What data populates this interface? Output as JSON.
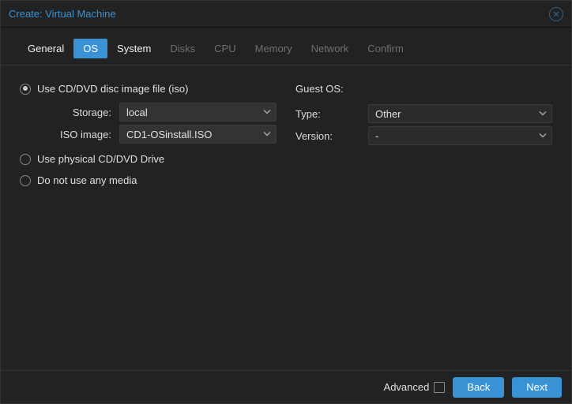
{
  "title": "Create: Virtual Machine",
  "tabs": [
    {
      "label": "General",
      "state": "enabled"
    },
    {
      "label": "OS",
      "state": "active"
    },
    {
      "label": "System",
      "state": "enabled"
    },
    {
      "label": "Disks",
      "state": "disabled"
    },
    {
      "label": "CPU",
      "state": "disabled"
    },
    {
      "label": "Memory",
      "state": "disabled"
    },
    {
      "label": "Network",
      "state": "disabled"
    },
    {
      "label": "Confirm",
      "state": "disabled"
    }
  ],
  "media": {
    "opt_iso": "Use CD/DVD disc image file (iso)",
    "opt_physical": "Use physical CD/DVD Drive",
    "opt_none": "Do not use any media",
    "storage_label": "Storage:",
    "storage_value": "local",
    "iso_label": "ISO image:",
    "iso_value": "CD1-OSinstall.ISO"
  },
  "guest": {
    "heading": "Guest OS:",
    "type_label": "Type:",
    "type_value": "Other",
    "version_label": "Version:",
    "version_value": "-"
  },
  "footer": {
    "advanced": "Advanced",
    "back": "Back",
    "next": "Next"
  }
}
